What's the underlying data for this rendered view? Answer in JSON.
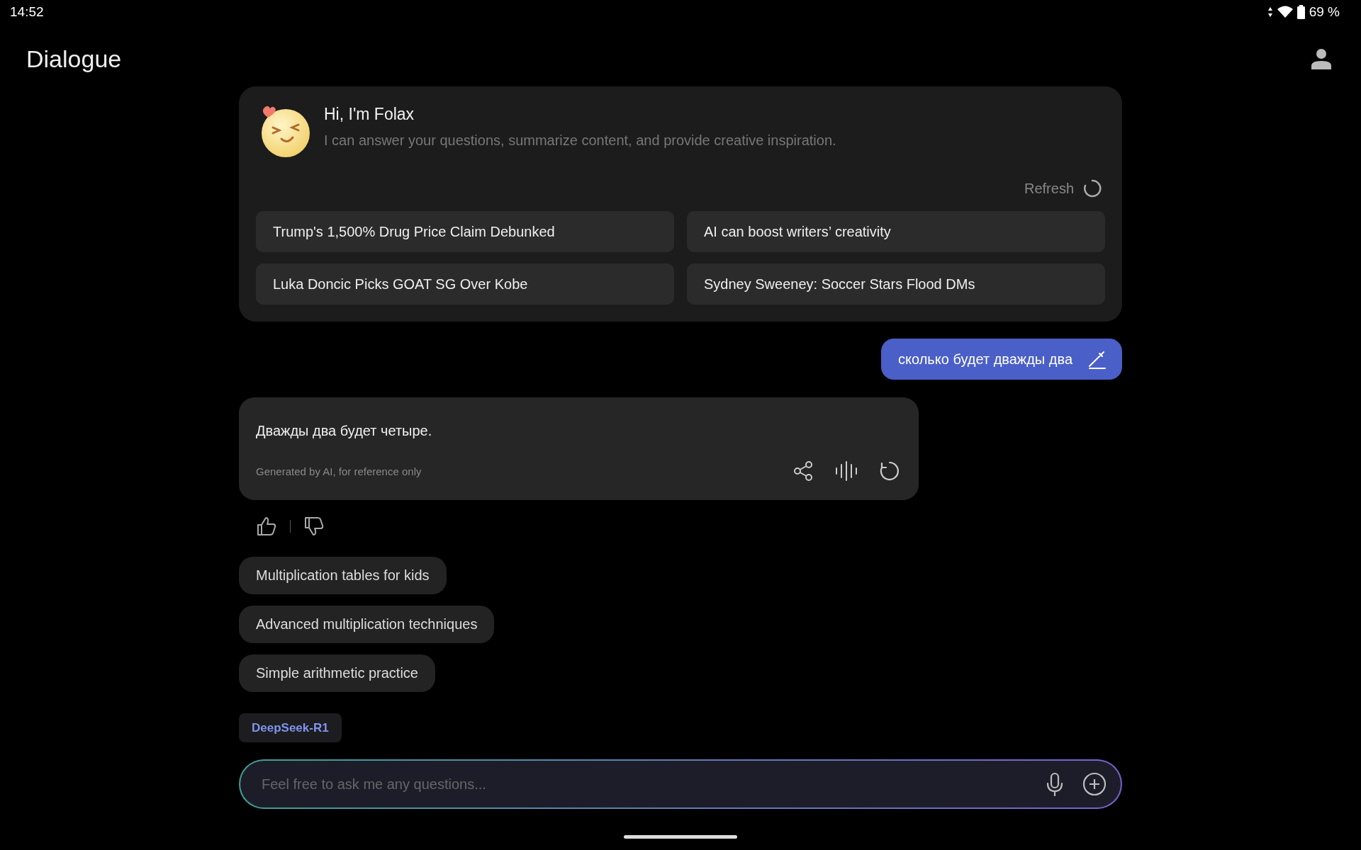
{
  "status_bar": {
    "time": "14:52",
    "battery": "69 %"
  },
  "header": {
    "title": "Dialogue"
  },
  "welcome": {
    "title": "Hi, I'm Folax",
    "subtitle": "I can answer your questions, summarize content, and provide creative inspiration.",
    "refresh": "Refresh",
    "topics": [
      {
        "text": "Trump's 1,500% Drug Price Claim Debunked"
      },
      {
        "text": "AI can boost writers’ creativity"
      },
      {
        "text": "Luka Doncic Picks GOAT SG Over Kobe"
      },
      {
        "text": "Sydney Sweeney: Soccer Stars Flood DMs"
      }
    ]
  },
  "messages": [
    {
      "kind": "user",
      "text": "сколько будет дважды два"
    },
    {
      "kind": "assistant",
      "text": "Дважды два будет четыре.",
      "note": "Generated by AI, for reference only"
    }
  ],
  "suggestions": [
    {
      "text": "Multiplication tables for kids"
    },
    {
      "text": "Advanced multiplication techniques"
    },
    {
      "text": "Simple arithmetic practice"
    }
  ],
  "model": "DeepSeek-R1",
  "input": {
    "placeholder": "Feel free to ask me any questions..."
  }
}
